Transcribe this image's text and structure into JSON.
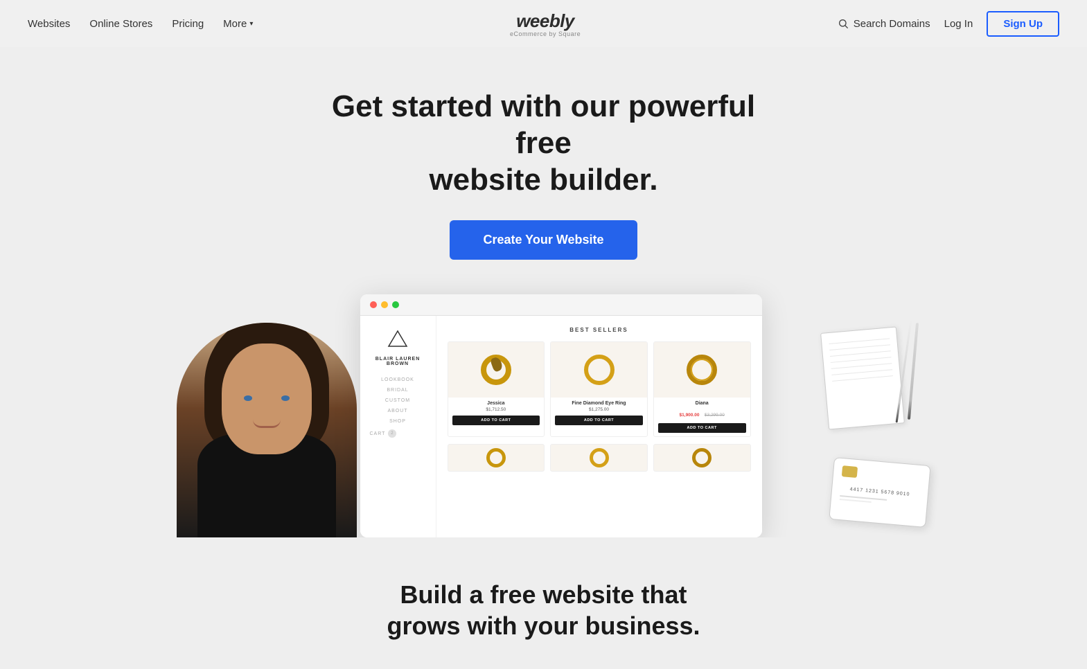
{
  "nav": {
    "logo": "weebly",
    "logo_sub": "eCommerce by Square",
    "links": [
      {
        "label": "Websites",
        "id": "websites"
      },
      {
        "label": "Online Stores",
        "id": "online-stores"
      },
      {
        "label": "Pricing",
        "id": "pricing"
      },
      {
        "label": "More",
        "id": "more"
      }
    ],
    "search_label": "Search Domains",
    "login_label": "Log In",
    "signup_label": "Sign Up"
  },
  "hero": {
    "headline_line1": "Get started with our powerful free",
    "headline_line2": "website builder.",
    "cta_label": "Create Your Website"
  },
  "mockup": {
    "site_logo_name": "BLAIR LAUREN BROWN",
    "nav_items": [
      "LOOKBOOK",
      "BRIDAL",
      "CUSTOM",
      "ABOUT",
      "SHOP",
      "CART"
    ],
    "cart_count": "2",
    "section_title": "BEST SELLERS",
    "products": [
      {
        "name": "Jessica",
        "price": "$1,712.50",
        "sale": false
      },
      {
        "name": "Fine Diamond Eye Ring",
        "price": "$1,275.00",
        "sale": false
      },
      {
        "name": "Diana",
        "price_sale": "$1,900.00",
        "price_orig": "$3,299.00",
        "sale": true
      }
    ],
    "add_to_cart": "ADD TO CART"
  },
  "credit_card": {
    "number": "4417 1231 5678 9010"
  },
  "bottom": {
    "headline_line1": "Build a free website that",
    "headline_line2": "grows with your business."
  }
}
